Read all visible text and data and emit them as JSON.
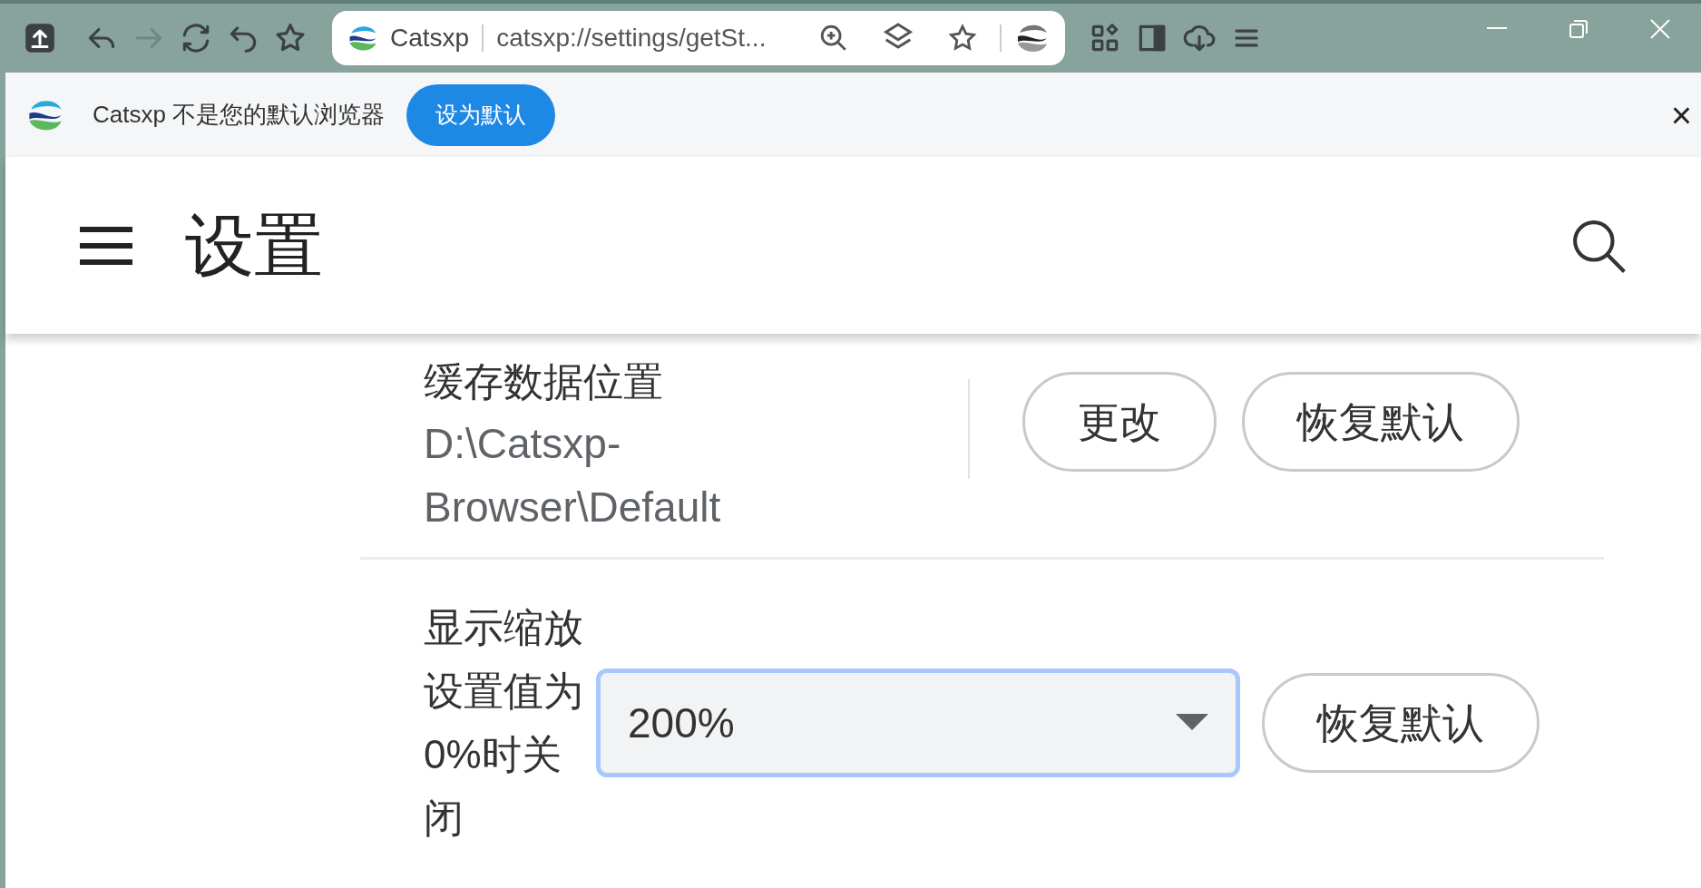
{
  "toolbar": {
    "site_name": "Catsxp",
    "url": "catsxp://settings/getSt..."
  },
  "banner": {
    "message": "Catsxp 不是您的默认浏览器",
    "button": "设为默认",
    "close": "×"
  },
  "header": {
    "title": "设置"
  },
  "settings": [
    {
      "kind": "path",
      "label": "缓存数据位置",
      "value": "D:\\Catsxp-Browser\\Default",
      "buttons": [
        "更改",
        "恢复默认"
      ]
    },
    {
      "kind": "select",
      "label": "显示缩放设置值为0%时关闭",
      "value": "200%",
      "focused": true,
      "buttons": [
        "恢复默认"
      ]
    }
  ]
}
